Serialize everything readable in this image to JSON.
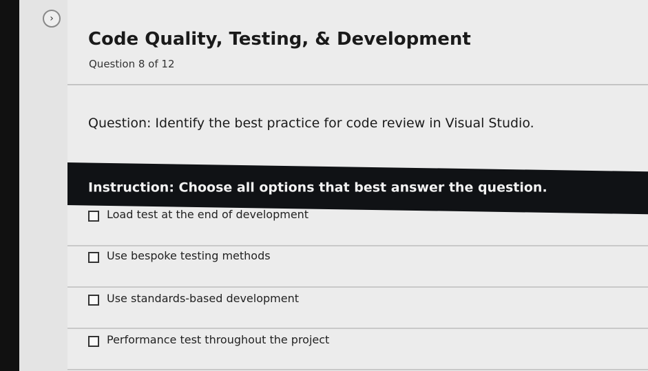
{
  "nav": {
    "expand_glyph": "›"
  },
  "quiz": {
    "title": "Code Quality, Testing, & Development",
    "progress": "Question 8 of 12",
    "question": "Question: Identify the best practice for code review in Visual Studio.",
    "instruction": "Instruction: Choose all options that best answer the question.",
    "options": [
      {
        "label": "Load test at the end of development",
        "checked": false
      },
      {
        "label": "Use bespoke testing methods",
        "checked": false
      },
      {
        "label": "Use standards-based development",
        "checked": false
      },
      {
        "label": "Performance test throughout the project",
        "checked": false
      }
    ]
  },
  "colors": {
    "instruction_bg": "#101215",
    "page_bg": "#ececec",
    "text": "#1a1a1a"
  }
}
